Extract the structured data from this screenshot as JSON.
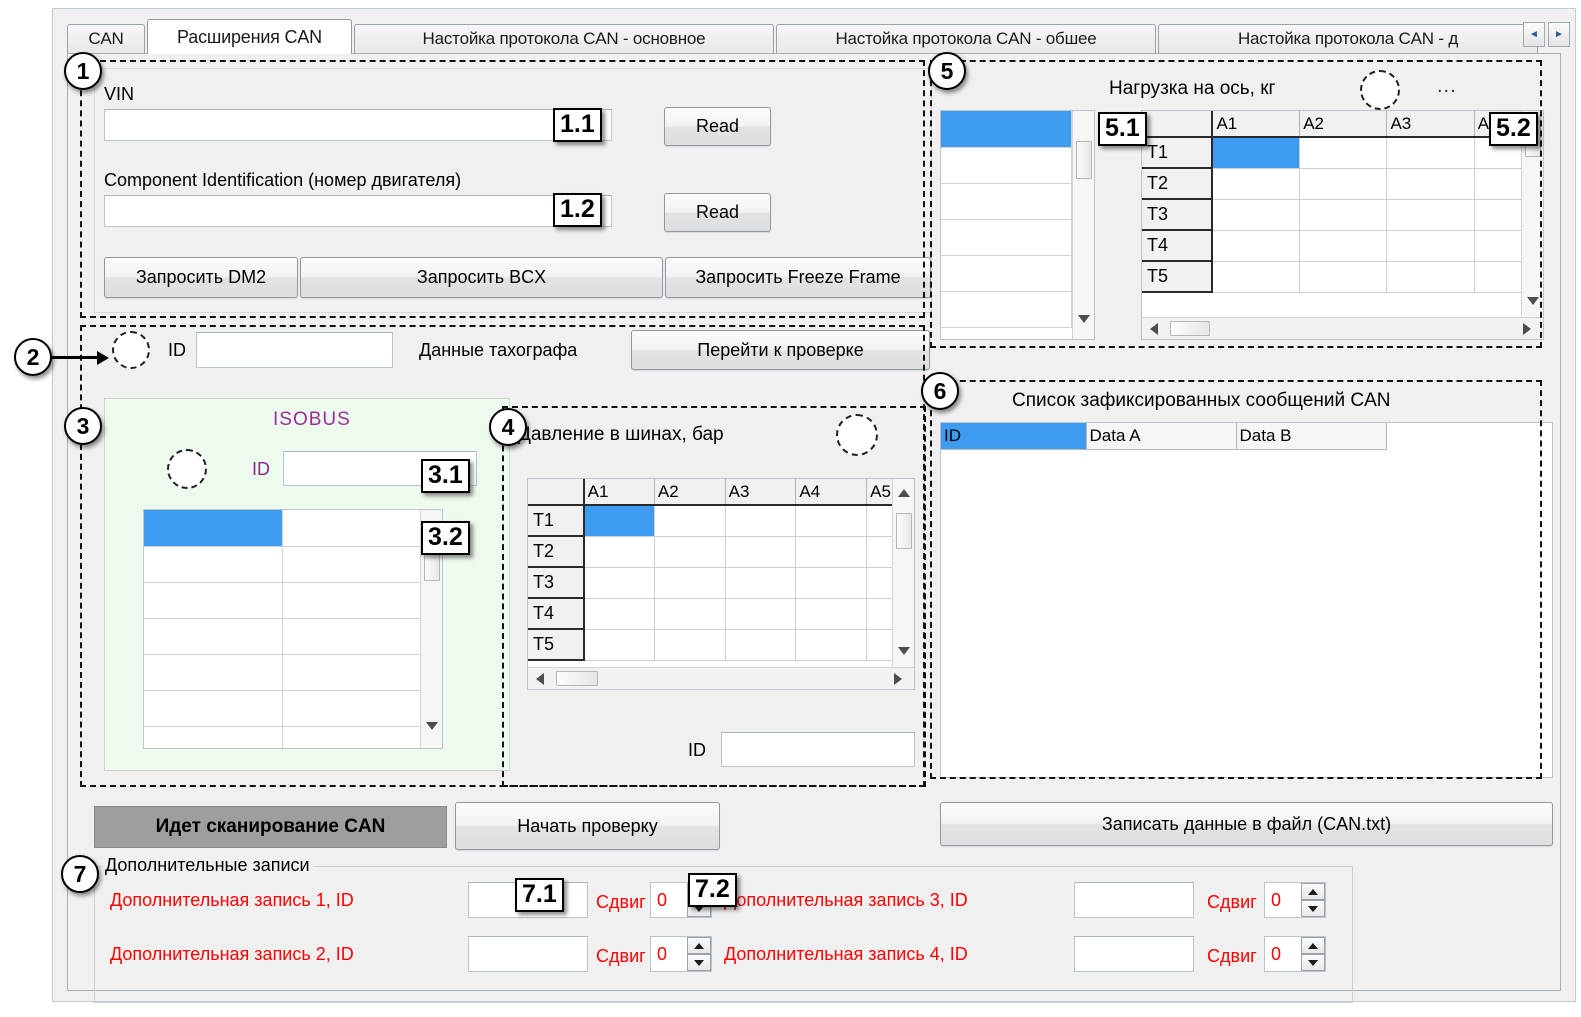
{
  "window": {
    "tabs": [
      {
        "label": "CAN",
        "active": false
      },
      {
        "label": "Расширения CAN",
        "active": true
      },
      {
        "label": "Настойка протокола CAN - основное",
        "active": false
      },
      {
        "label": "Настойка протокола CAN - обшее",
        "active": false
      },
      {
        "label": "Настойка протокола CAN - д",
        "active": false
      }
    ],
    "tab_scroll_left": "◄",
    "tab_scroll_right": "►"
  },
  "callouts": {
    "c1": "1",
    "c1_1": "1.1",
    "c1_2": "1.2",
    "c2": "2",
    "c3": "3",
    "c3_1": "3.1",
    "c3_2": "3.2",
    "c4": "4",
    "c5": "5",
    "c5_1": "5.1",
    "c5_2": "5.2",
    "c6": "6",
    "c7": "7",
    "c7_1": "7.1",
    "c7_2": "7.2"
  },
  "section1": {
    "vin_label": "VIN",
    "vin_value": "",
    "vin_read_button": "Read",
    "component_label": "Component Identification (номер двигателя)",
    "component_value": "",
    "component_read_button": "Read",
    "buttons": [
      "Запросить DM2",
      "Запросить BCX",
      "Запросить Freeze Frame"
    ]
  },
  "section2": {
    "id_label": "ID",
    "id_value": "",
    "tacho_label": "Данные тахографа",
    "goto_check_button": "Перейти к проверке"
  },
  "section3": {
    "title": "ISOBUS",
    "id_label": "ID",
    "id_value": "",
    "rows": 7
  },
  "section4": {
    "title": "Давление в шинах, бар",
    "columns": [
      "A1",
      "A2",
      "A3",
      "A4",
      "A5"
    ],
    "rows": [
      "T1",
      "T2",
      "T3",
      "T4",
      "T5"
    ],
    "id_label": "ID",
    "id_value": ""
  },
  "section5": {
    "title": "Нагрузка на ось, кг",
    "ellipsis": "...",
    "list_rows": 6,
    "columns": [
      "A1",
      "A2",
      "A3",
      "A4"
    ],
    "rows": [
      "T1",
      "T2",
      "T3",
      "T4",
      "T5"
    ]
  },
  "section6": {
    "title": "Список зафиксированных сообщений CAN",
    "columns": [
      "ID",
      "Data A",
      "Data B"
    ],
    "rows": []
  },
  "footer": {
    "scan_status": "Идет сканирование CAN",
    "start_check_button": "Начать проверку",
    "write_file_button": "Записать данные в файл (CAN.txt)"
  },
  "section7": {
    "caption": "Дополнительные записи",
    "records": [
      {
        "label": "Дополнительная запись 1, ID",
        "id_value": "",
        "shift_label": "Сдвиг",
        "shift_value": "0"
      },
      {
        "label": "Дополнительная запись 2, ID",
        "id_value": "",
        "shift_label": "Сдвиг",
        "shift_value": "0"
      },
      {
        "label": "Дополнительная запись 3, ID",
        "id_value": "",
        "shift_label": "Сдвиг",
        "shift_value": "0"
      },
      {
        "label": "Дополнительная запись 4, ID",
        "id_value": "",
        "shift_label": "Сдвиг",
        "shift_value": "0"
      }
    ]
  },
  "colors": {
    "selection_blue": "#3d9cf0",
    "isobus_purple": "#9b2d9b",
    "record_red": "#ff0000",
    "isobus_panel_green": "#edfaee",
    "scan_status_gray": "#9e9e9e"
  }
}
